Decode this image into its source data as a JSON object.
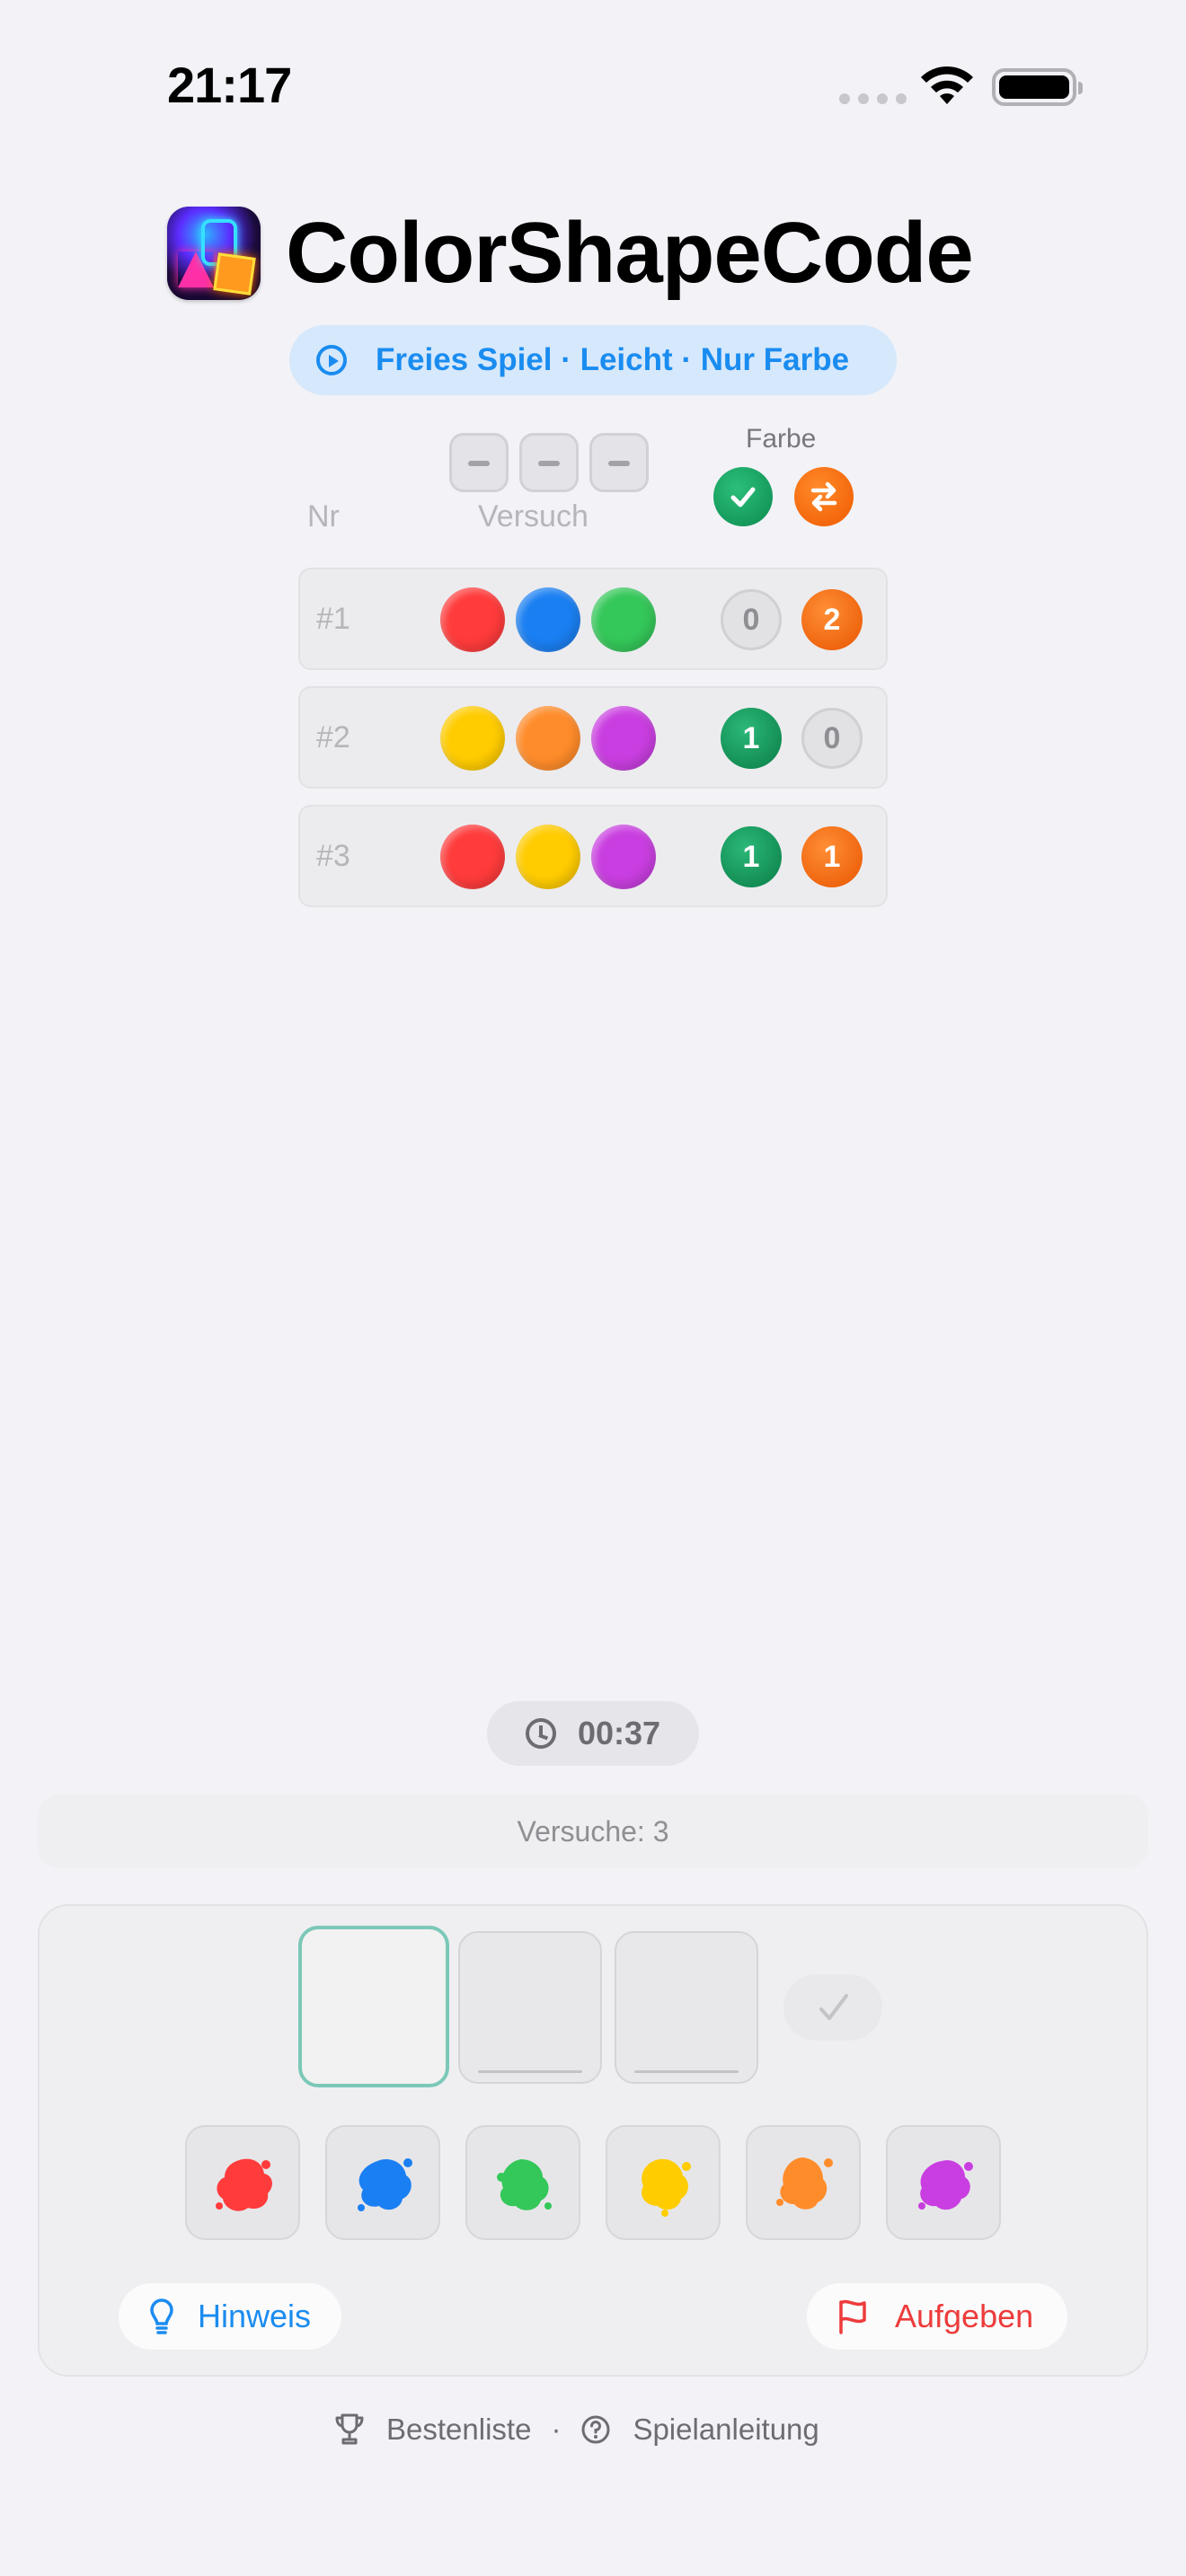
{
  "status_bar": {
    "time": "21:17"
  },
  "header": {
    "app_title": "ColorShapeCode",
    "mode_label": "Freies Spiel · Leicht · Nur Farbe"
  },
  "board": {
    "col_nr": "Nr",
    "col_versuch": "Versuch",
    "col_farbe": "Farbe",
    "rows": [
      {
        "label": "#1",
        "pegs": [
          "red",
          "blue",
          "green"
        ],
        "correct": "0",
        "misplaced": "2"
      },
      {
        "label": "#2",
        "pegs": [
          "yellow",
          "orange",
          "purple"
        ],
        "correct": "1",
        "misplaced": "0"
      },
      {
        "label": "#3",
        "pegs": [
          "red",
          "yellow",
          "purple"
        ],
        "correct": "1",
        "misplaced": "1"
      }
    ]
  },
  "timer": {
    "value": "00:37",
    "icon": "clock-icon"
  },
  "attempts_label": "Versuche: 3",
  "input": {
    "palette": [
      "red",
      "blue",
      "green",
      "yellow",
      "orange",
      "purple"
    ],
    "hint_label": "Hinweis",
    "give_up_label": "Aufgeben"
  },
  "footer": {
    "leaderboard_label": "Bestenliste",
    "separator": "·",
    "instructions_label": "Spielanleitung"
  },
  "colors": {
    "red": "#ff3b3b",
    "blue": "#1a7ff2",
    "green": "#34c759",
    "yellow": "#ffcc00",
    "orange": "#ff8c2a",
    "purple": "#c93ee0",
    "accent": "#1a8cf0",
    "danger": "#ee3b3b"
  }
}
